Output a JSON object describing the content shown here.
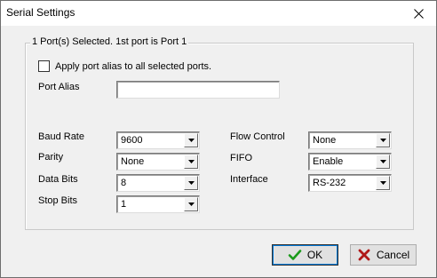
{
  "window": {
    "title": "Serial Settings",
    "close_glyph": "×"
  },
  "group": {
    "legend": "1 Port(s) Selected. 1st port is Port 1"
  },
  "alias": {
    "apply_all_label": "Apply port alias to all selected ports.",
    "apply_all_checked": false,
    "label": "Port Alias",
    "value": ""
  },
  "settings": {
    "baud_rate": {
      "label": "Baud Rate",
      "value": "9600"
    },
    "parity": {
      "label": "Parity",
      "value": "None"
    },
    "data_bits": {
      "label": "Data Bits",
      "value": "8"
    },
    "stop_bits": {
      "label": "Stop Bits",
      "value": "1"
    },
    "flow_control": {
      "label": "Flow Control",
      "value": "None"
    },
    "fifo": {
      "label": "FIFO",
      "value": "Enable"
    },
    "interface": {
      "label": "Interface",
      "value": "RS-232"
    }
  },
  "buttons": {
    "ok": {
      "label": "OK",
      "icon": "checkmark-icon",
      "color": "#1a9a1a"
    },
    "cancel": {
      "label": "Cancel",
      "icon": "red-x-icon",
      "color": "#b01818"
    }
  }
}
